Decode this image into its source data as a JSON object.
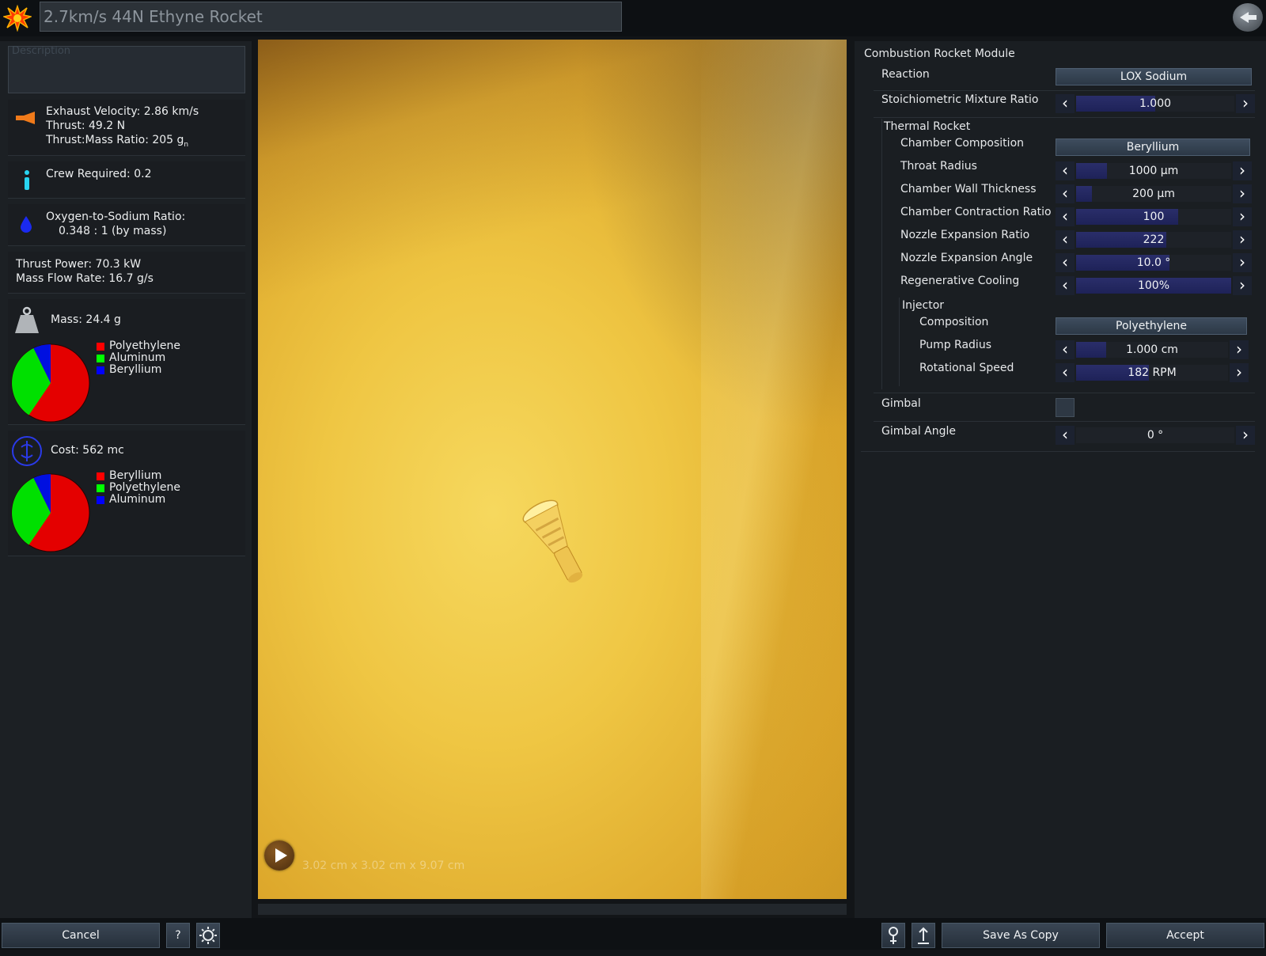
{
  "header": {
    "title": "2.7km/s 44N Ethyne Rocket",
    "app_icon": "explosion-icon",
    "back_icon": "back-arrow-icon"
  },
  "left": {
    "description_placeholder": "Description",
    "engine": {
      "exhaust_velocity": "Exhaust Velocity: 2.86 km/s",
      "thrust": "Thrust: 49.2 N",
      "thrust_mass_ratio": "Thrust:Mass Ratio: 205 g",
      "thrust_mass_unit_sub": "n"
    },
    "crew": "Crew Required: 0.2",
    "ratio": {
      "label": "Oxygen-to-Sodium Ratio:",
      "value": "0.348 : 1 (by mass)"
    },
    "power": {
      "thrust_power": "Thrust Power: 70.3 kW",
      "mass_flow": "Mass Flow Rate: 16.7 g/s"
    },
    "mass": {
      "label": "Mass: 24.4 g",
      "legend": [
        {
          "label": "Polyethylene",
          "color": "#ff0000"
        },
        {
          "label": "Aluminum",
          "color": "#00ff00"
        },
        {
          "label": "Beryllium",
          "color": "#0000ff"
        }
      ]
    },
    "cost": {
      "label": "Cost: 562 mc",
      "legend": [
        {
          "label": "Beryllium",
          "color": "#ff0000"
        },
        {
          "label": "Polyethylene",
          "color": "#00ff00"
        },
        {
          "label": "Aluminum",
          "color": "#0000ff"
        }
      ]
    }
  },
  "viewport": {
    "dimensions": "3.02 cm x 3.02 cm x 9.07 cm",
    "play_icon": "play-icon"
  },
  "right": {
    "module_title": "Combustion Rocket Module",
    "reaction": {
      "label": "Reaction",
      "value": "LOX Sodium"
    },
    "mixture": {
      "label": "Stoichiometric Mixture Ratio",
      "value": "1.000",
      "level": 0.5
    },
    "thermal": {
      "title": "Thermal Rocket",
      "chamber_composition": {
        "label": "Chamber Composition",
        "value": "Beryllium"
      },
      "throat_radius": {
        "label": "Throat Radius",
        "value": "1000 µm",
        "level": 0.2
      },
      "wall_thickness": {
        "label": "Chamber Wall Thickness",
        "value": "200 µm",
        "level": 0.1
      },
      "contraction_ratio": {
        "label": "Chamber Contraction Ratio",
        "value": "100",
        "level": 0.66
      },
      "expansion_ratio": {
        "label": "Nozzle Expansion Ratio",
        "value": "222",
        "level": 0.58
      },
      "expansion_angle": {
        "label": "Nozzle Expansion Angle",
        "value": "10.0 °",
        "level": 0.6
      },
      "regen_cooling": {
        "label": "Regenerative Cooling",
        "value": "100%",
        "level": 1.0
      },
      "injector": {
        "title": "Injector",
        "composition": {
          "label": "Composition",
          "value": "Polyethylene"
        },
        "pump_radius": {
          "label": "Pump Radius",
          "value": "1.000 cm",
          "level": 0.2
        },
        "rotational_speed": {
          "label": "Rotational Speed",
          "value": "182 RPM",
          "level": 0.48
        }
      }
    },
    "gimbal": {
      "label": "Gimbal"
    },
    "gimbal_angle": {
      "label": "Gimbal Angle",
      "value": "0 °",
      "level": 0.0
    }
  },
  "footer": {
    "cancel": "Cancel",
    "help": "?",
    "save_as_copy": "Save As Copy",
    "accept": "Accept"
  }
}
